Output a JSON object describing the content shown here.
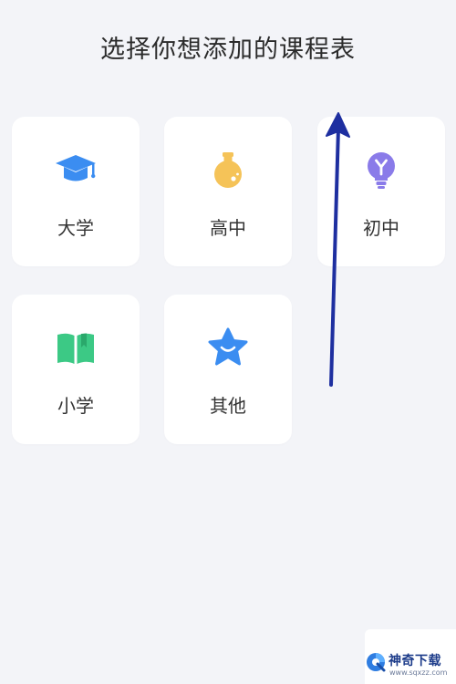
{
  "header": {
    "title": "选择你想添加的课程表"
  },
  "categories": [
    {
      "label": "大学",
      "icon": "graduation-cap-icon",
      "color": "#3b8df1"
    },
    {
      "label": "高中",
      "icon": "flask-icon",
      "color": "#f5c358"
    },
    {
      "label": "初中",
      "icon": "lightbulb-icon",
      "color": "#8a7be9"
    },
    {
      "label": "小学",
      "icon": "book-icon",
      "color": "#3cc985"
    },
    {
      "label": "其他",
      "icon": "star-icon",
      "color": "#3b8df1"
    }
  ],
  "annotation": {
    "arrow_color": "#1e2fa0"
  },
  "watermark": {
    "name": "神奇下载",
    "url": "www.sqxzz.com"
  }
}
